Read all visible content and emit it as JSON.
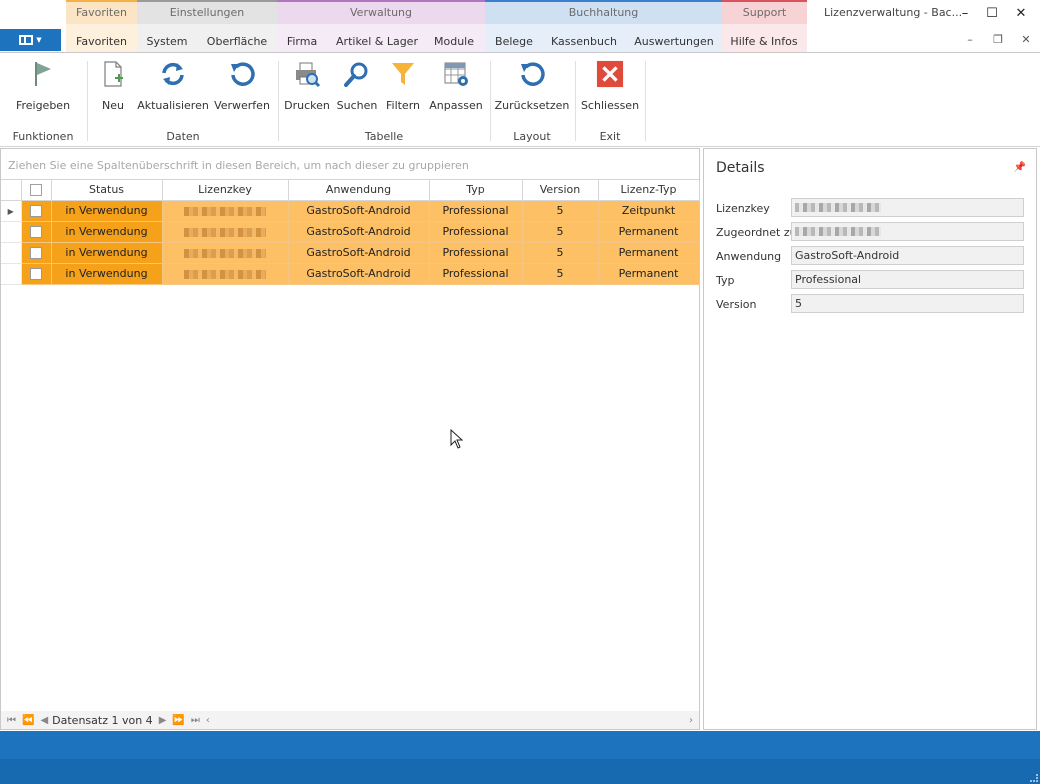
{
  "window": {
    "title": "Lizenzverwaltung - Bac..."
  },
  "tab_groups": [
    {
      "label": "Favoriten"
    },
    {
      "label": "Einstellungen"
    },
    {
      "label": "Verwaltung"
    },
    {
      "label": "Buchhaltung"
    },
    {
      "label": "Support"
    }
  ],
  "tabs": [
    {
      "label": "Favoriten"
    },
    {
      "label": "System"
    },
    {
      "label": "Oberfläche"
    },
    {
      "label": "Firma"
    },
    {
      "label": "Artikel & Lager"
    },
    {
      "label": "Module"
    },
    {
      "label": "Belege"
    },
    {
      "label": "Kassenbuch"
    },
    {
      "label": "Auswertungen"
    },
    {
      "label": "Hilfe & Infos"
    }
  ],
  "ribbon": {
    "buttons": [
      {
        "label": "Freigeben",
        "icon": "flag-icon"
      },
      {
        "label": "Neu",
        "icon": "new-document-icon"
      },
      {
        "label": "Aktualisieren",
        "icon": "refresh-icon"
      },
      {
        "label": "Verwerfen",
        "icon": "undo-icon"
      },
      {
        "label": "Drucken",
        "icon": "print-preview-icon"
      },
      {
        "label": "Suchen",
        "icon": "search-icon"
      },
      {
        "label": "Filtern",
        "icon": "filter-icon"
      },
      {
        "label": "Anpassen",
        "icon": "table-settings-icon"
      },
      {
        "label": "Zurücksetzen",
        "icon": "reset-icon"
      },
      {
        "label": "Schliessen",
        "icon": "close-icon"
      }
    ],
    "groups": [
      {
        "label": "Funktionen"
      },
      {
        "label": "Daten"
      },
      {
        "label": "Tabelle"
      },
      {
        "label": "Layout"
      },
      {
        "label": "Exit"
      }
    ]
  },
  "grid": {
    "group_hint": "Ziehen Sie eine Spaltenüberschrift in diesen Bereich, um nach dieser zu gruppieren",
    "columns": [
      "Status",
      "Lizenzkey",
      "Anwendung",
      "Typ",
      "Version",
      "Lizenz-Typ"
    ],
    "rows": [
      {
        "status": "in Verwendung",
        "anwendung": "GastroSoft-Android",
        "typ": "Professional",
        "version": "5",
        "lizenz_typ": "Zeitpunkt"
      },
      {
        "status": "in Verwendung",
        "anwendung": "GastroSoft-Android",
        "typ": "Professional",
        "version": "5",
        "lizenz_typ": "Permanent"
      },
      {
        "status": "in Verwendung",
        "anwendung": "GastroSoft-Android",
        "typ": "Professional",
        "version": "5",
        "lizenz_typ": "Permanent"
      },
      {
        "status": "in Verwendung",
        "anwendung": "GastroSoft-Android",
        "typ": "Professional",
        "version": "5",
        "lizenz_typ": "Permanent"
      }
    ],
    "navigator_text": "Datensatz 1 von 4"
  },
  "details": {
    "title": "Details",
    "fields": [
      {
        "label": "Lizenzkey",
        "value": ""
      },
      {
        "label": "Zugeordnet zu",
        "value": ""
      },
      {
        "label": "Anwendung",
        "value": "GastroSoft-Android"
      },
      {
        "label": "Typ",
        "value": "Professional"
      },
      {
        "label": "Version",
        "value": "5"
      }
    ]
  },
  "colors": {
    "accent_blue": "#1e73be",
    "row_highlight": "#fdc064",
    "status_cell": "#f5a11a",
    "close_red": "#e04a3a"
  }
}
